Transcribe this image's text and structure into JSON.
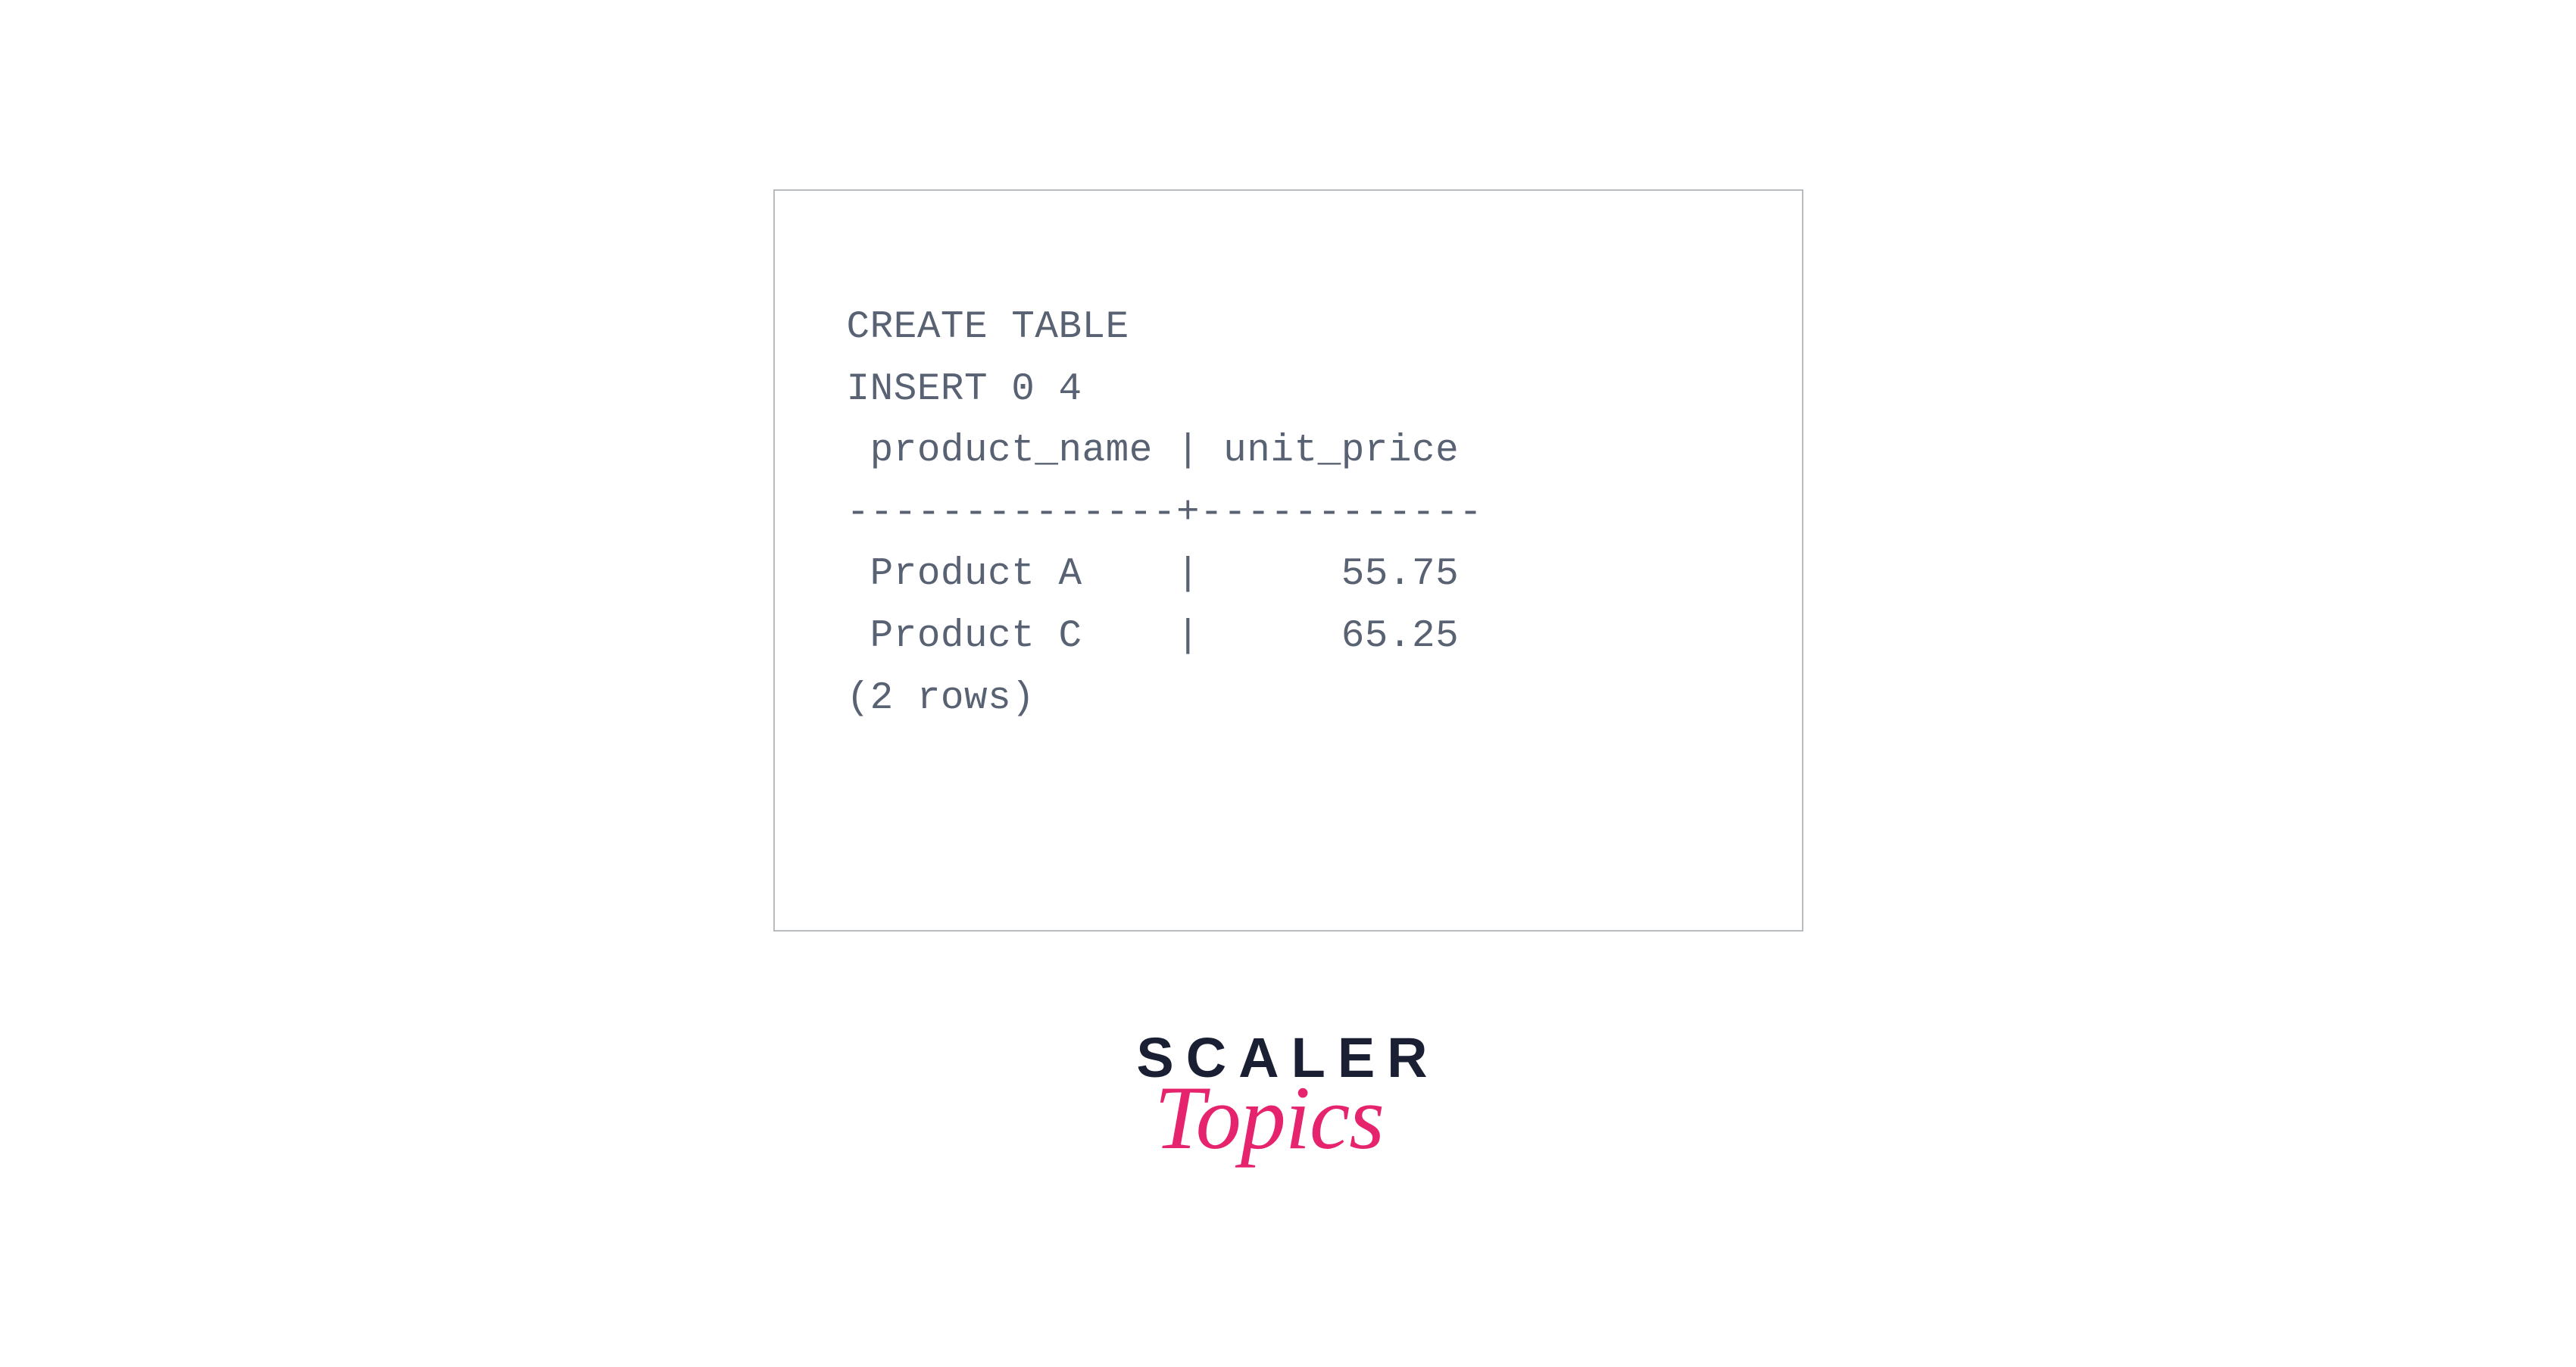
{
  "code": {
    "line1": "CREATE TABLE",
    "line2": "INSERT 0 4",
    "line3": " product_name | unit_price",
    "line4": "--------------+------------",
    "line5": " Product A    |      55.75",
    "line6": " Product C    |      65.25",
    "line7": "(2 rows)"
  },
  "logo": {
    "top": "SCALER",
    "bottom": "Topics"
  }
}
